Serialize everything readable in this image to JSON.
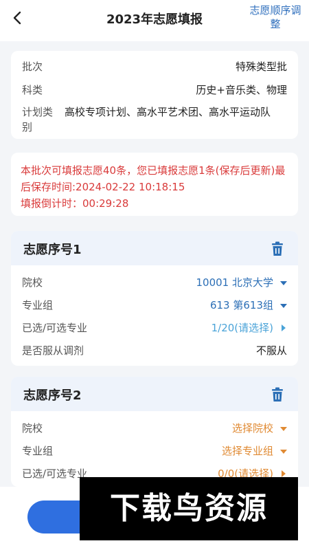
{
  "header": {
    "title": "2023年志愿填报",
    "action": "志愿顺序调整"
  },
  "info": {
    "batch_label": "批次",
    "batch_value": "特殊类型批",
    "subject_label": "科类",
    "subject_value": "历史+音乐类、物理",
    "plan_label": "计划类别",
    "plan_value": "高校专项计划、高水平艺术团、高水平运动队"
  },
  "notice": {
    "text": "本批次可填报志愿40条，您已填报志愿1条(保存后更新)最后保存时间:2024-02-22 10:18:15",
    "countdown": "填报倒计时：00:29:28"
  },
  "choices": [
    {
      "title": "志愿序号1",
      "school_label": "院校",
      "school_value": "10001 北京大学",
      "group_label": "专业组",
      "group_value": "613 第613组",
      "major_label": "已选/可选专业",
      "major_value": "1/20(请选择)",
      "adjust_label": "是否服从调剂",
      "adjust_value": "不服从"
    },
    {
      "title": "志愿序号2",
      "school_label": "院校",
      "school_value": "选择院校",
      "group_label": "专业组",
      "group_value": "选择专业组",
      "major_label": "已选/可选专业",
      "major_value": "0/0(请选择)"
    }
  ],
  "watermark": "下载鸟资源",
  "colors": {
    "accent": "#2c6fb6",
    "warning": "#d93a3a",
    "pending": "#e08a33"
  }
}
